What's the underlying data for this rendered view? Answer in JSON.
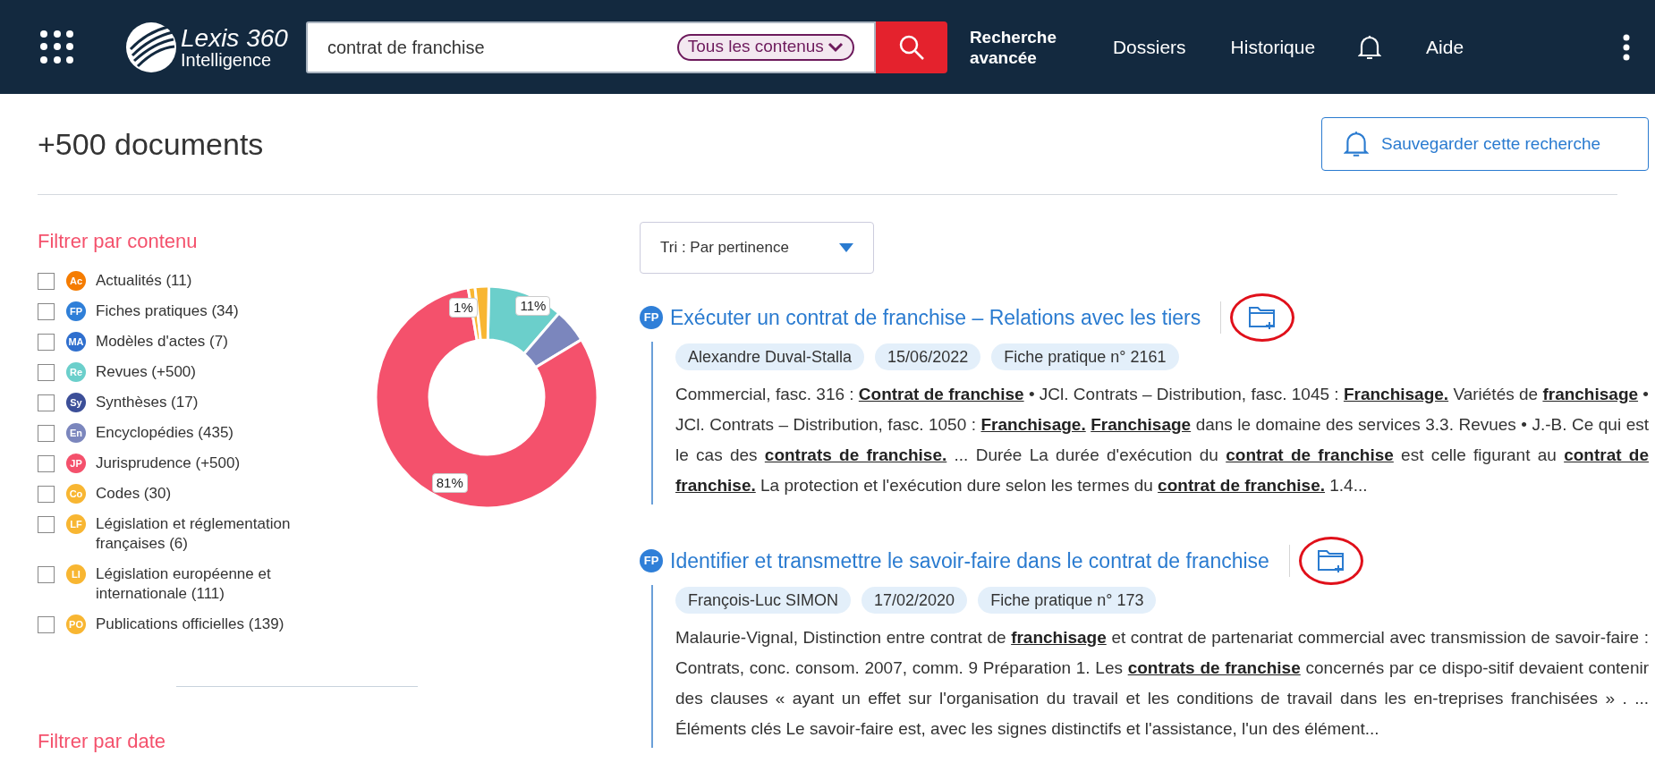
{
  "header": {
    "logo_name": "Lexis 360",
    "logo_sub": "Intelligence",
    "search": {
      "value": "contrat de franchise",
      "scope": "Tous les contenus"
    },
    "nav": [
      {
        "kind": "text",
        "label": "Recherche avancée",
        "bold": true
      },
      {
        "kind": "text",
        "label": "Dossiers",
        "bold": false
      },
      {
        "kind": "text",
        "label": "Historique",
        "bold": false
      },
      {
        "kind": "bell"
      },
      {
        "kind": "text",
        "label": "Aide",
        "bold": false
      },
      {
        "kind": "more"
      }
    ]
  },
  "results_count": "+500 documents",
  "save_search": "Sauvegarder cette recherche",
  "filters": {
    "title": "Filtrer par contenu",
    "items": [
      {
        "badge": "Ac",
        "label": "Actualités (11)",
        "color": "#f57c00",
        "checked": false
      },
      {
        "badge": "FP",
        "label": "Fiches pratiques (34)",
        "color": "#2f7fd8",
        "checked": false
      },
      {
        "badge": "MA",
        "label": "Modèles d'actes (7)",
        "color": "#2f6fce",
        "checked": false
      },
      {
        "badge": "Re",
        "label": "Revues (+500)",
        "color": "#6bcfcb",
        "checked": false
      },
      {
        "badge": "Sy",
        "label": "Synthèses (17)",
        "color": "#3c4f98",
        "checked": false
      },
      {
        "badge": "En",
        "label": "Encyclopédies (435)",
        "color": "#7b86bd",
        "checked": false
      },
      {
        "badge": "JP",
        "label": "Jurisprudence (+500)",
        "color": "#f4516c",
        "checked": false
      },
      {
        "badge": "Co",
        "label": "Codes (30)",
        "color": "#f8b632",
        "checked": false
      },
      {
        "badge": "LF",
        "label": "Législation et réglementation françaises (6)",
        "color": "#f8b632",
        "checked": false
      },
      {
        "badge": "LI",
        "label": "Législation européenne et internationale (111)",
        "color": "#f8b632",
        "checked": false
      },
      {
        "badge": "PO",
        "label": "Publications officielles (139)",
        "color": "#f8b632",
        "checked": false
      }
    ],
    "chart_data": {
      "type": "donut",
      "values": [
        11,
        5,
        81,
        1,
        2
      ],
      "colors": [
        "#6bcfcb",
        "#7b86bd",
        "#f4516c",
        "#f8b632",
        "#f8b632"
      ],
      "value_labels": [
        "11%",
        null,
        "81%",
        "1%",
        null
      ]
    },
    "date_title": "Filtrer par date"
  },
  "sort": {
    "label": "Tri : Par pertinence"
  },
  "results": [
    {
      "badge": "FP",
      "title": "Exécuter un contrat de franchise – Relations avec les tiers",
      "highlighted": true,
      "tags": [
        "Alexandre Duval-Stalla",
        "15/06/2022",
        "Fiche pratique n° 2161"
      ],
      "snippet": "Commercial, fasc. 316  : **Contrat de franchise** • JCl. Contrats – Distribution, fasc. 1045  : **Franchisage.** Variétés de **franchisage** • JCl. Contrats – Distribution, fasc. 1050  : **Franchisage.** **Franchisage** dans le domaine des services 3.3. Revues • J.-B. Ce qui est le cas des **contrats de franchise.** ... Durée La durée d'exécution du **contrat de franchise** est celle figurant au **contrat de franchise.** La protection et l'exécution dure selon les termes du **contrat de franchise.** 1.4..."
    },
    {
      "badge": "FP",
      "title": "Identifier et transmettre le savoir-faire dans le contrat de franchise",
      "highlighted": true,
      "tags": [
        "François-Luc SIMON",
        "17/02/2020",
        "Fiche pratique n° 173"
      ],
      "snippet": "Malaurie-Vignal, Distinction entre contrat de **franchisage** et contrat de partenariat commercial avec transmission de savoir-faire : Contrats, conc. consom. 2007, comm. 9 Préparation 1. Les **contrats de franchise** concernés par ce dispo-sitif devaient contenir des clauses « ayant un effet sur l'organisation du travail et les conditions de travail dans les en-treprises franchisées » . ... Éléments clés Le savoir-faire est, avec les signes distinctifs et l'assistance, l'un des élément..."
    }
  ]
}
